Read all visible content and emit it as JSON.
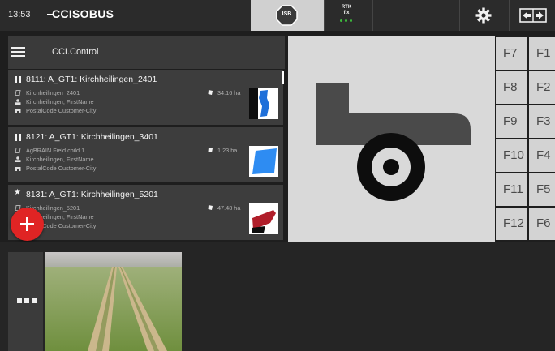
{
  "status_bar": {
    "time": "13:53",
    "logo_text": "CCISOBUS",
    "isb_badge": "ISB",
    "rtk_line1": "RTK",
    "rtk_line2": "fix",
    "rtk_status_color": "#3dbb3d",
    "settings_icon": "gear-icon",
    "switch_icon": "terminal-switch-icon"
  },
  "app_header": {
    "menu_icon": "hamburger-icon",
    "title": "CCI.Control"
  },
  "jobs": [
    {
      "state": "paused",
      "title": "8111: A_GT1: Kirchheilingen_2401",
      "field": "Kirchheilingen_2401",
      "customer": "Kirchheilingen, FirstName",
      "address": "PostalCode Customer-City",
      "area": "34.16 ha",
      "thumb_color": "#1e6fd9"
    },
    {
      "state": "paused",
      "title": "8121: A_GT1: Kirchheilingen_3401",
      "field": "AgBRAIN Field child 1",
      "customer": "Kirchheilingen, FirstName",
      "address": "PostalCode Customer-City",
      "area": "1.23 ha",
      "thumb_color": "#2e8cf2"
    },
    {
      "state": "favorite",
      "title": "8131: A_GT1: Kirchheilingen_5201",
      "field": "Kirchheilingen_5201",
      "customer": "Kirchheilingen, FirstName",
      "address": "PostalCode Customer-City",
      "area": "47.48 ha",
      "thumb_color": "#b01e2a"
    }
  ],
  "add_button_icon": "plus-icon",
  "machine_icon": "trailer-machine-icon",
  "function_keys": {
    "col1": [
      "F7",
      "F8",
      "F9",
      "F10",
      "F11",
      "F12"
    ],
    "col2": [
      "F1",
      "F2",
      "F3",
      "F4",
      "F5",
      "F6"
    ]
  },
  "bottom": {
    "more_icon": "more-dots-icon",
    "camera_view": "field-camera-view"
  }
}
